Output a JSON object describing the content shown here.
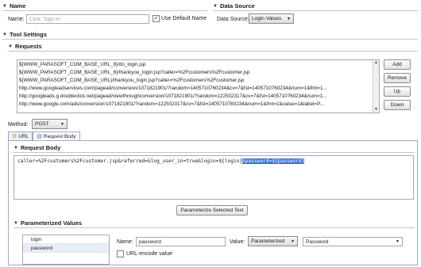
{
  "name_section": {
    "title": "Name",
    "name_label": "Name:",
    "name_placeholder": "Click \"Sign In\"",
    "use_default_label": "Use Default Name"
  },
  "data_source_section": {
    "title": "Data Source",
    "label": "Data Source:",
    "selected": "Login Values"
  },
  "tool_settings": {
    "title": "Tool Settings"
  },
  "requests": {
    "title": "Requests",
    "items": [
      "${WWW_PARASOFT_COM_BASE_URL_8}/do_login.jsp",
      "${WWW_PARASOFT_COM_BASE_URL_8}/thankyou_login.jsp?caller=%2Fcustomers%2Fcustomer.jsp",
      "${WWW_PARASOFT_COM_BASE_URL}/thankyou_login.jsp?caller=%2Fcustomers%2Fcustomer.jsp",
      "http://www.googleadservices.com/pagead/conversion/1071821901/?random=1405710760234&cv=7&fst=1405710760234&num=1&fmt=1...",
      "http://googleads.g.doubleclick.net/pagead/viewthroughconversion/1071821901/?random=122502317&cv=7&fst=1405710760234&num=1...",
      "http://www.google.com/ads/conversion/1071821901/?random=122502317&cv=7&fst=1405710760234&num=1&fmt=1&value=1&label=P..."
    ],
    "buttons": {
      "add": "Add",
      "remove": "Remove",
      "up": "Up",
      "down": "Down"
    }
  },
  "method": {
    "label": "Method:",
    "selected": "POST"
  },
  "tabs": {
    "url": "URL",
    "request_body": "Request Body"
  },
  "request_body": {
    "title": "Request Body",
    "text_prefix": "caller=%2Fcustomers%2Fcustomer.jsp&referred=&log_user_in=true&login=${login}",
    "text_selected": "&password=${password}",
    "parameterize_button": "Parameterize Selected Text"
  },
  "parameterized_values": {
    "title": "Parameterized Values",
    "items": [
      "login",
      "password"
    ],
    "selected_index": 1,
    "name_label": "Name:",
    "name_value": "password",
    "value_label": "Value:",
    "value_mode": "Parameterized",
    "value_column": "Password",
    "url_encode_label": "URL-encode value"
  },
  "colors": {
    "selection": "#3874d8",
    "rule": "#b8c7dd"
  },
  "icons": {
    "section_toggle": "triangle-down-icon",
    "url_tab": "globe-icon",
    "request_body_tab": "document-icon"
  }
}
